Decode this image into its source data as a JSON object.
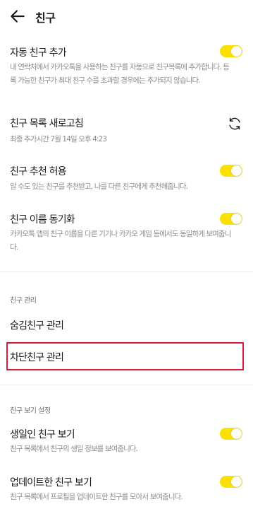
{
  "header": {
    "title": "친구"
  },
  "auto_add": {
    "title": "자동 친구 추가",
    "desc": "내 연락처에서 카카오톡을 사용하는 친구를 자동으로 친구목록에 추가합니다. 등록 가능한 친구가 최대 친구 수를 초과할 경우에는 추가되지 않습니다.",
    "enabled": true
  },
  "refresh": {
    "title": "친구 목록 새로고침",
    "desc": "최종 추가시간 7월 14일 오후 4:23"
  },
  "recommend": {
    "title": "친구 추천 허용",
    "desc": "알 수도 있는 친구를 추천받고, 나를 다른 친구에게 추천해줍니다.",
    "enabled": true
  },
  "name_sync": {
    "title": "친구 이름 동기화",
    "desc": "카카오톡 앱의 친구 이름을 다른 기기나 카카오 게임 등에서도 동일하게 보여줍니다.",
    "enabled": true
  },
  "manage": {
    "section_label": "친구 관리",
    "hidden_label": "숨김친구 관리",
    "blocked_label": "차단친구 관리"
  },
  "view": {
    "section_label": "친구 보기 설정",
    "birthday_title": "생일인 친구 보기",
    "birthday_desc": "친구 목록에서 친구의 생일 정보를 보여줍니다.",
    "birthday_enabled": true,
    "updated_title": "업데이트한 친구 보기",
    "updated_desc": "친구 목록에서 프로필을 업데이트한 친구를 모아서 보여줍니다.",
    "updated_enabled": true
  },
  "colors": {
    "accent": "#fae100",
    "highlight": "#d61f35"
  }
}
